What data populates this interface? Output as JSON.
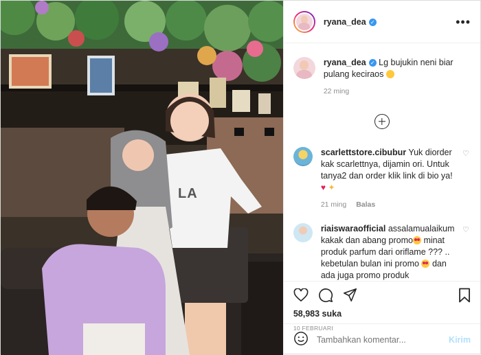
{
  "post": {
    "author": {
      "username": "ryana_dea",
      "verified_icon": "verified-badge-icon",
      "more_icon": "more-dots-icon"
    },
    "caption": {
      "username": "ryana_dea",
      "text": "Lg bujukin neni biar pulang keciraos",
      "emoji": "grinning-sweat-emoji",
      "time": "22 ming"
    },
    "load_more_icon": "plus-circle-icon",
    "comments": [
      {
        "username": "scarlettstore.cibubur",
        "text": "Yuk diorder kak scarlettnya, dijamin ori. Untuk tanya2 dan order klik link di bio ya!",
        "emoji": [
          "red-heart-emoji",
          "sparkles-emoji"
        ],
        "time": "21 ming",
        "reply": "Balas",
        "like_icon": "heart-outline-icon"
      },
      {
        "username": "riaiswaraofficial",
        "text1": "assalamualaikum kakak dan abang promo",
        "text2": "minat produk parfum dari oriflame ??? .. kebetulan bulan ini promo",
        "text3": "dan ada juga promo produk",
        "emoji": "heart-eyes-emoji",
        "like_icon": "heart-outline-icon"
      }
    ],
    "actions": {
      "like_icon": "heart-outline-icon",
      "comment_icon": "comment-bubble-icon",
      "share_icon": "paper-plane-icon",
      "save_icon": "bookmark-icon"
    },
    "likes": "58,983 suka",
    "date": "10 FEBRUARI",
    "add_comment": {
      "emoji_icon": "smiley-icon",
      "placeholder": "Tambahkan komentar...",
      "submit": "Kirim"
    },
    "photo_shirt_logo": "LA"
  },
  "colors": {
    "link_blue": "#3897f0",
    "send_disabled": "#b2dffc",
    "meta_gray": "#8e8e8e",
    "border": "#dbdbdb"
  }
}
